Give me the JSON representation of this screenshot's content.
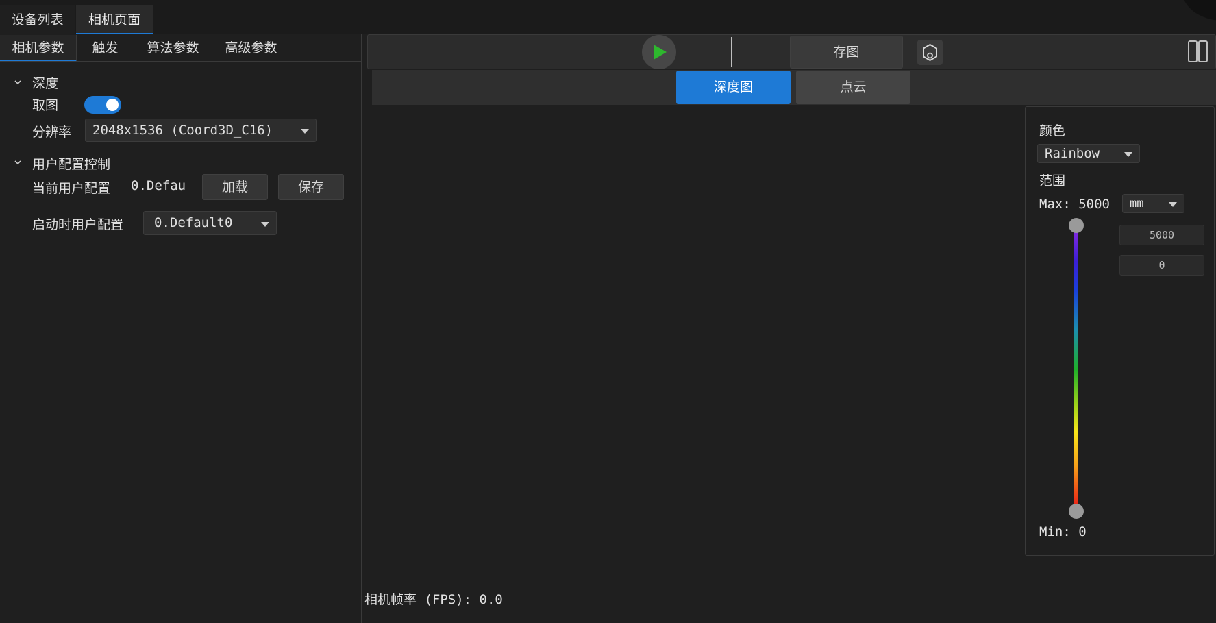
{
  "top_tabs": [
    {
      "label": "设备列表",
      "active": false
    },
    {
      "label": "相机页面",
      "active": true
    }
  ],
  "sub_tabs": [
    {
      "label": "相机参数",
      "active": true
    },
    {
      "label": "触发",
      "active": false
    },
    {
      "label": "算法参数",
      "active": false
    },
    {
      "label": "高级参数",
      "active": false
    }
  ],
  "depth_section": {
    "title": "深度",
    "capture_label": "取图",
    "capture_enabled": true,
    "resolution_label": "分辨率",
    "resolution_value": "2048x1536 (Coord3D_C16)"
  },
  "user_config_section": {
    "title": "用户配置控制",
    "current_label": "当前用户配置",
    "current_value": "0.Defau",
    "load_label": "加载",
    "save_label": "保存",
    "startup_label": "启动时用户配置",
    "startup_value": "0.Default0"
  },
  "toolbar": {
    "save_image_label": "存图"
  },
  "view_tabs": [
    {
      "label": "深度图",
      "active": true
    },
    {
      "label": "点云",
      "active": false
    }
  ],
  "color_panel": {
    "color_label": "颜色",
    "colormap_value": "Rainbow",
    "range_label": "范围",
    "max_text": "Max: 5000",
    "unit_value": "mm",
    "max_input": "5000",
    "min_input": "0",
    "min_text": "Min: 0"
  },
  "status": {
    "fps_text": "相机帧率 (FPS): 0.0"
  },
  "colors": {
    "accent": "#1e7ad6",
    "play_green": "#2eb82e",
    "background": "#1f1f1f"
  },
  "icons": [
    "chevron-down-icon",
    "play-icon",
    "hexagon-icon",
    "split-view-icon",
    "caret-down-icon"
  ]
}
